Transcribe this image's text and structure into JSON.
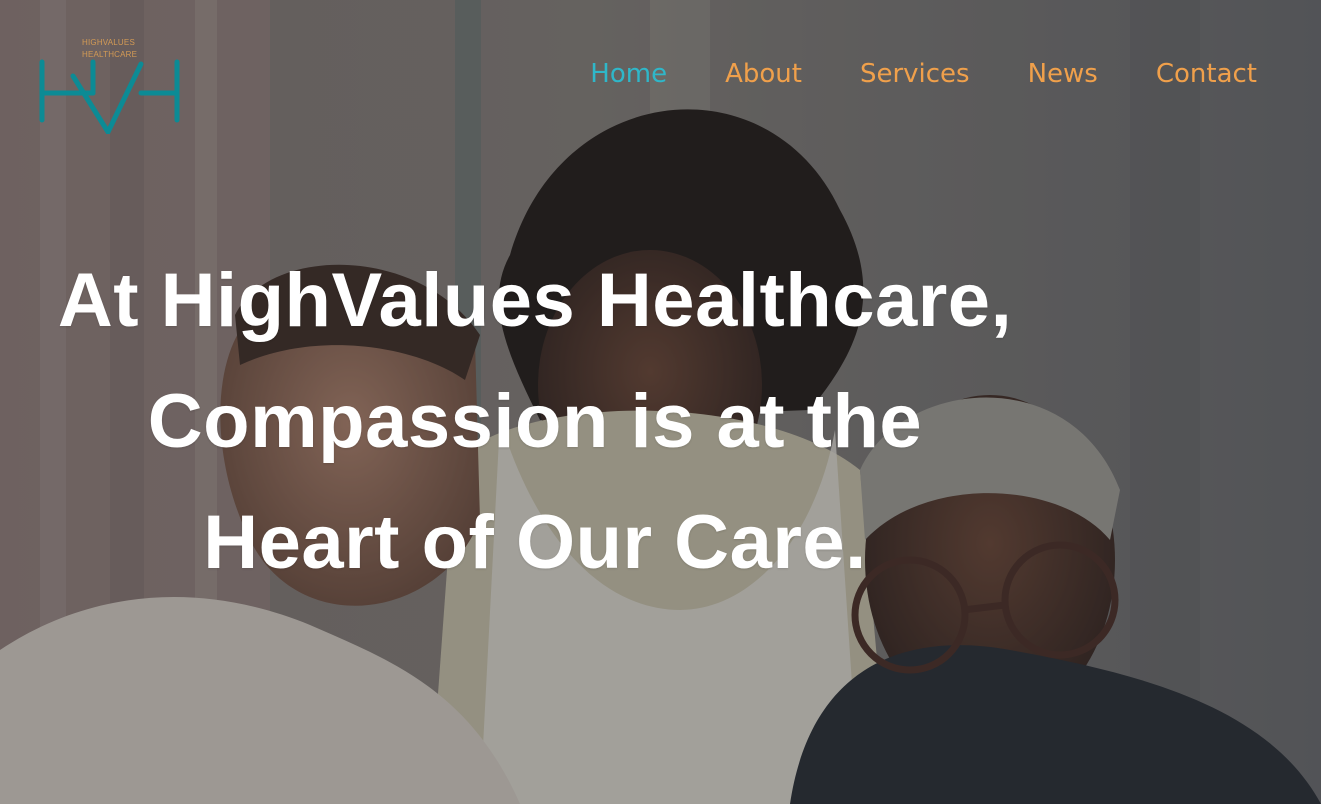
{
  "logo": {
    "line1": "HIGHVALUES",
    "line2": "HEALTHCARE",
    "letters": "HvH"
  },
  "nav": {
    "items": [
      {
        "label": "Home",
        "active": true
      },
      {
        "label": "About",
        "active": false
      },
      {
        "label": "Services",
        "active": false
      },
      {
        "label": "News",
        "active": false
      },
      {
        "label": "Contact",
        "active": false
      }
    ]
  },
  "hero": {
    "headline": "At HighValues Healthcare, Compassion is at the Heart of Our Care."
  },
  "colors": {
    "nav": "#f0a04b",
    "accent": "#2fb7c9",
    "logo_mark": "#0c8b95",
    "logo_text": "#d39a55"
  }
}
